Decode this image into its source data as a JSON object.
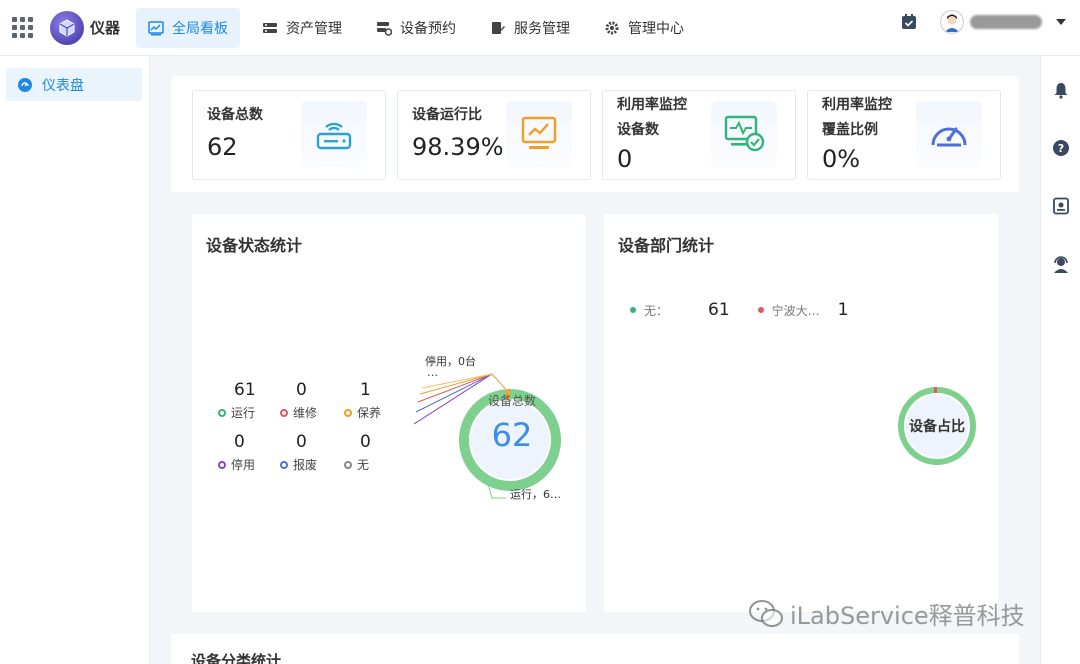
{
  "brand": "仪器",
  "nav": [
    {
      "label": "全局看板",
      "icon": "dashboard-icon",
      "active": true
    },
    {
      "label": "资产管理",
      "icon": "asset-icon"
    },
    {
      "label": "设备预约",
      "icon": "booking-icon"
    },
    {
      "label": "服务管理",
      "icon": "service-icon"
    },
    {
      "label": "管理中心",
      "icon": "gear-icon"
    }
  ],
  "sidebar": {
    "items": [
      {
        "label": "仪表盘",
        "icon": "dashboard-dial-icon"
      }
    ]
  },
  "stats": [
    {
      "label": "设备总数",
      "value": "62",
      "icon": "router-icon",
      "color": "#29a3d6"
    },
    {
      "label": "设备运行比",
      "value": "98.39%",
      "icon": "monitor-chart-icon",
      "color": "#f0a020"
    },
    {
      "label": "利用率监控\n设备数",
      "value": "0",
      "icon": "monitor-check-icon",
      "color": "#2fb57a"
    },
    {
      "label": "利用率监控\n覆盖比例",
      "value": "0%",
      "icon": "speedometer-icon",
      "color": "#4f6fd6"
    }
  ],
  "status_panel": {
    "title": "设备状态统计",
    "legend": [
      {
        "count": "61",
        "label": "运行",
        "color": "#2fb57a"
      },
      {
        "count": "0",
        "label": "维修",
        "color": "#e05a5a"
      },
      {
        "count": "1",
        "label": "保养",
        "color": "#f0a020"
      },
      {
        "count": "0",
        "label": "停用",
        "color": "#8a3fc7"
      },
      {
        "count": "0",
        "label": "报废",
        "color": "#4f6fd6"
      },
      {
        "count": "0",
        "label": "无",
        "color": "#888888"
      }
    ],
    "donut_center_label": "设备总数",
    "donut_center_value": "62",
    "callout_top": "停用，0台",
    "callout_top_more": "…",
    "callout_bottom": "运行，6…"
  },
  "dept_panel": {
    "title": "设备部门统计",
    "legend": [
      {
        "label": "无：",
        "value": "61",
        "color": "#2fb57a"
      },
      {
        "label": "宁波大…",
        "value": "1",
        "color": "#e05a5a"
      }
    ],
    "donut_center_label": "设备占比"
  },
  "bottom_section_title": "设备分类统计",
  "watermark": "iLabService释普科技",
  "chart_data": [
    {
      "type": "pie",
      "title": "设备状态统计",
      "categories": [
        "运行",
        "维修",
        "保养",
        "停用",
        "报废",
        "无"
      ],
      "values": [
        61,
        0,
        1,
        0,
        0,
        0
      ],
      "colors": [
        "#7ed08f",
        "#e05a5a",
        "#f0a020",
        "#8a3fc7",
        "#4f6fd6",
        "#888888"
      ]
    },
    {
      "type": "pie",
      "title": "设备部门统计",
      "categories": [
        "无",
        "宁波大…"
      ],
      "values": [
        61,
        1
      ],
      "colors": [
        "#7ed08f",
        "#e05a5a"
      ]
    }
  ]
}
